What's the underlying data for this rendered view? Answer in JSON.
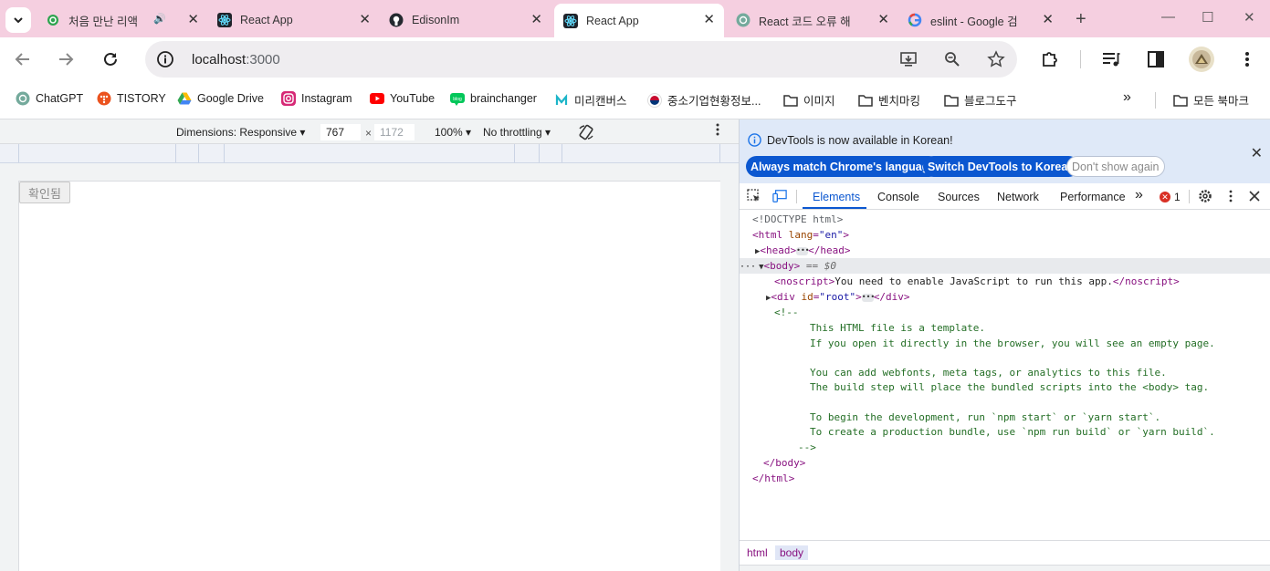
{
  "browser": {
    "tabs": [
      {
        "title": "처음 만난 리액",
        "icon": "tab-favicon-green-icon",
        "audio": true
      },
      {
        "title": "React App",
        "icon": "react-icon"
      },
      {
        "title": "EdisonIm",
        "icon": "github-icon"
      },
      {
        "title": "React App",
        "icon": "react-icon",
        "active": true
      },
      {
        "title": "React 코드 오류 해",
        "icon": "chatgpt-icon"
      },
      {
        "title": "eslint - Google 검",
        "icon": "google-icon"
      }
    ],
    "url_host": "localhost",
    "url_port": ":3000",
    "bookmarks": [
      {
        "label": "ChatGPT",
        "icon": "chatgpt-icon"
      },
      {
        "label": "TISTORY",
        "icon": "tistory-icon"
      },
      {
        "label": "Google Drive",
        "icon": "google-drive-icon"
      },
      {
        "label": "Instagram",
        "icon": "instagram-icon"
      },
      {
        "label": "YouTube",
        "icon": "youtube-icon"
      },
      {
        "label": "brainchanger",
        "icon": "blog-icon"
      },
      {
        "label": "미리캔버스",
        "icon": "miricanvas-icon"
      },
      {
        "label": "중소기업현황정보...",
        "icon": "korea-flag-icon"
      },
      {
        "label": "이미지",
        "icon": "folder-icon"
      },
      {
        "label": "벤치마킹",
        "icon": "folder-icon"
      },
      {
        "label": "블로그도구",
        "icon": "folder-icon"
      }
    ],
    "bookmarks_overflow": "»",
    "all_bookmarks": "모든 북마크"
  },
  "device_toolbar": {
    "dimensions_label": "Dimensions: Responsive",
    "width": "767",
    "times": "×",
    "height_placeholder": "1172",
    "zoom": "100%",
    "throttling": "No throttling"
  },
  "app": {
    "button_label": "확인됨"
  },
  "devtools": {
    "info_message": "DevTools is now available in Korean!",
    "btn_match": "Always match Chrome's language",
    "btn_switch": "Switch DevTools to Korean",
    "btn_dont_show": "Don't show again",
    "tabs": [
      "Elements",
      "Console",
      "Sources",
      "Network",
      "Performance"
    ],
    "more_tabs": "»",
    "error_count": "1",
    "dom": {
      "doctype": "<!DOCTYPE html>",
      "html_open": "<html",
      "html_attr": "lang",
      "html_val": "\"en\"",
      "head": "<head>",
      "head_close": "</head>",
      "body": "<body>",
      "eq": "== $0",
      "noscript_open": "<noscript>",
      "noscript_text": "You need to enable JavaScript to run this app.",
      "noscript_close": "</noscript>",
      "div_open": "<div",
      "div_attr": "id",
      "div_val": "\"root\"",
      "div_close": "</div>",
      "comment_open": "<!--",
      "comment_lines": [
        "This HTML file is a template.",
        "If you open it directly in the browser, you will see an empty page.",
        "",
        "You can add webfonts, meta tags, or analytics to this file.",
        "The build step will place the bundled scripts into the <body> tag.",
        "",
        "To begin the development, run `npm start` or `yarn start`.",
        "To create a production bundle, use `npm run build` or `yarn build`."
      ],
      "comment_close": "-->",
      "body_close": "</body>",
      "html_close": "</html>"
    },
    "breadcrumbs": [
      "html",
      "body"
    ]
  }
}
